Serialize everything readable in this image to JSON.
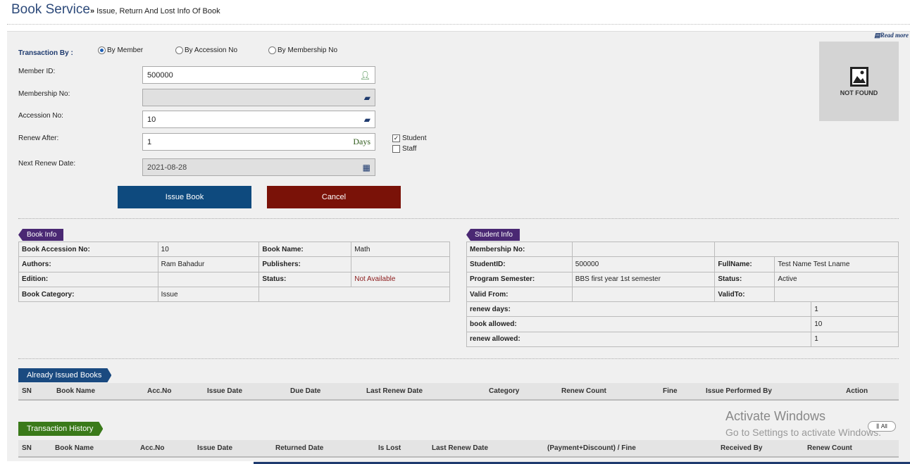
{
  "header": {
    "title": "Book Service",
    "subtitle": "Issue, Return And Lost Info Of Book",
    "arrow": "»"
  },
  "read_more": "Read more",
  "form": {
    "transaction_by_label": "Transaction By :",
    "radios": [
      {
        "label": "By Member",
        "selected": true
      },
      {
        "label": "By Accession No",
        "selected": false
      },
      {
        "label": "By Membership No",
        "selected": false
      }
    ],
    "member_id": {
      "label": "Member ID:",
      "value": "500000",
      "icon": "user-icon"
    },
    "membership_no": {
      "label": "Membership No:",
      "value": "",
      "icon": "book-icon"
    },
    "accession_no": {
      "label": "Accession No:",
      "value": "10",
      "icon": "book-icon"
    },
    "renew_after": {
      "label": "Renew After:",
      "value": "1",
      "suffix": "Days"
    },
    "next_renew_date": {
      "label": "Next Renew Date:",
      "value": "2021-08-28",
      "icon": "calendar-icon"
    },
    "checkboxes": [
      {
        "label": "Student",
        "checked": true
      },
      {
        "label": "Staff",
        "checked": false
      }
    ],
    "issue_button": "Issue Book",
    "cancel_button": "Cancel"
  },
  "photo": {
    "text": "NOT FOUND"
  },
  "book_info": {
    "tag": "Book Info",
    "rows": [
      [
        "Book Accession No:",
        "10",
        "Book Name:",
        "Math"
      ],
      [
        "Authors:",
        "Ram Bahadur",
        "Publishers:",
        ""
      ],
      [
        "Edition:",
        "",
        "Status:",
        "Not Available"
      ],
      [
        "Book Category:",
        "Issue",
        "",
        ""
      ]
    ]
  },
  "student_info": {
    "tag": "Student Info",
    "rows": [
      [
        "Membership No:",
        "",
        "",
        ""
      ],
      [
        "StudentID:",
        "500000",
        "FullName:",
        "Test Name Test Lname"
      ],
      [
        "Program Semester:",
        "BBS first year 1st semester",
        "Status:",
        "Active"
      ],
      [
        "Valid From:",
        "",
        "ValidTo:",
        ""
      ]
    ],
    "extra_rows": [
      [
        "renew days:",
        "1"
      ],
      [
        "book allowed:",
        "10"
      ],
      [
        "renew allowed:",
        "1"
      ]
    ]
  },
  "issued_books": {
    "tag": "Already Issued Books",
    "columns": [
      "SN",
      "Book Name",
      "Acc.No",
      "Issue Date",
      "Due Date",
      "Last Renew Date",
      "Category",
      "Renew Count",
      "Fine",
      "Issue Performed By",
      "Action"
    ]
  },
  "transaction_history": {
    "tag": "Transaction History",
    "columns": [
      "SN",
      "Book Name",
      "Acc.No",
      "Issue Date",
      "Returned Date",
      "Is Lost",
      "Last Renew Date",
      "(Payment+Discount) / Fine",
      "Received By",
      "Renew Count"
    ]
  },
  "watermark": {
    "line1": "Activate Windows",
    "line2": "Go to Settings to activate Windows."
  },
  "all_toggle": "All",
  "colors": {
    "primary": "#0e4a7e",
    "danger": "#7a1208",
    "tag_purple": "#4a2873",
    "tag_green": "#3a7a1a"
  }
}
